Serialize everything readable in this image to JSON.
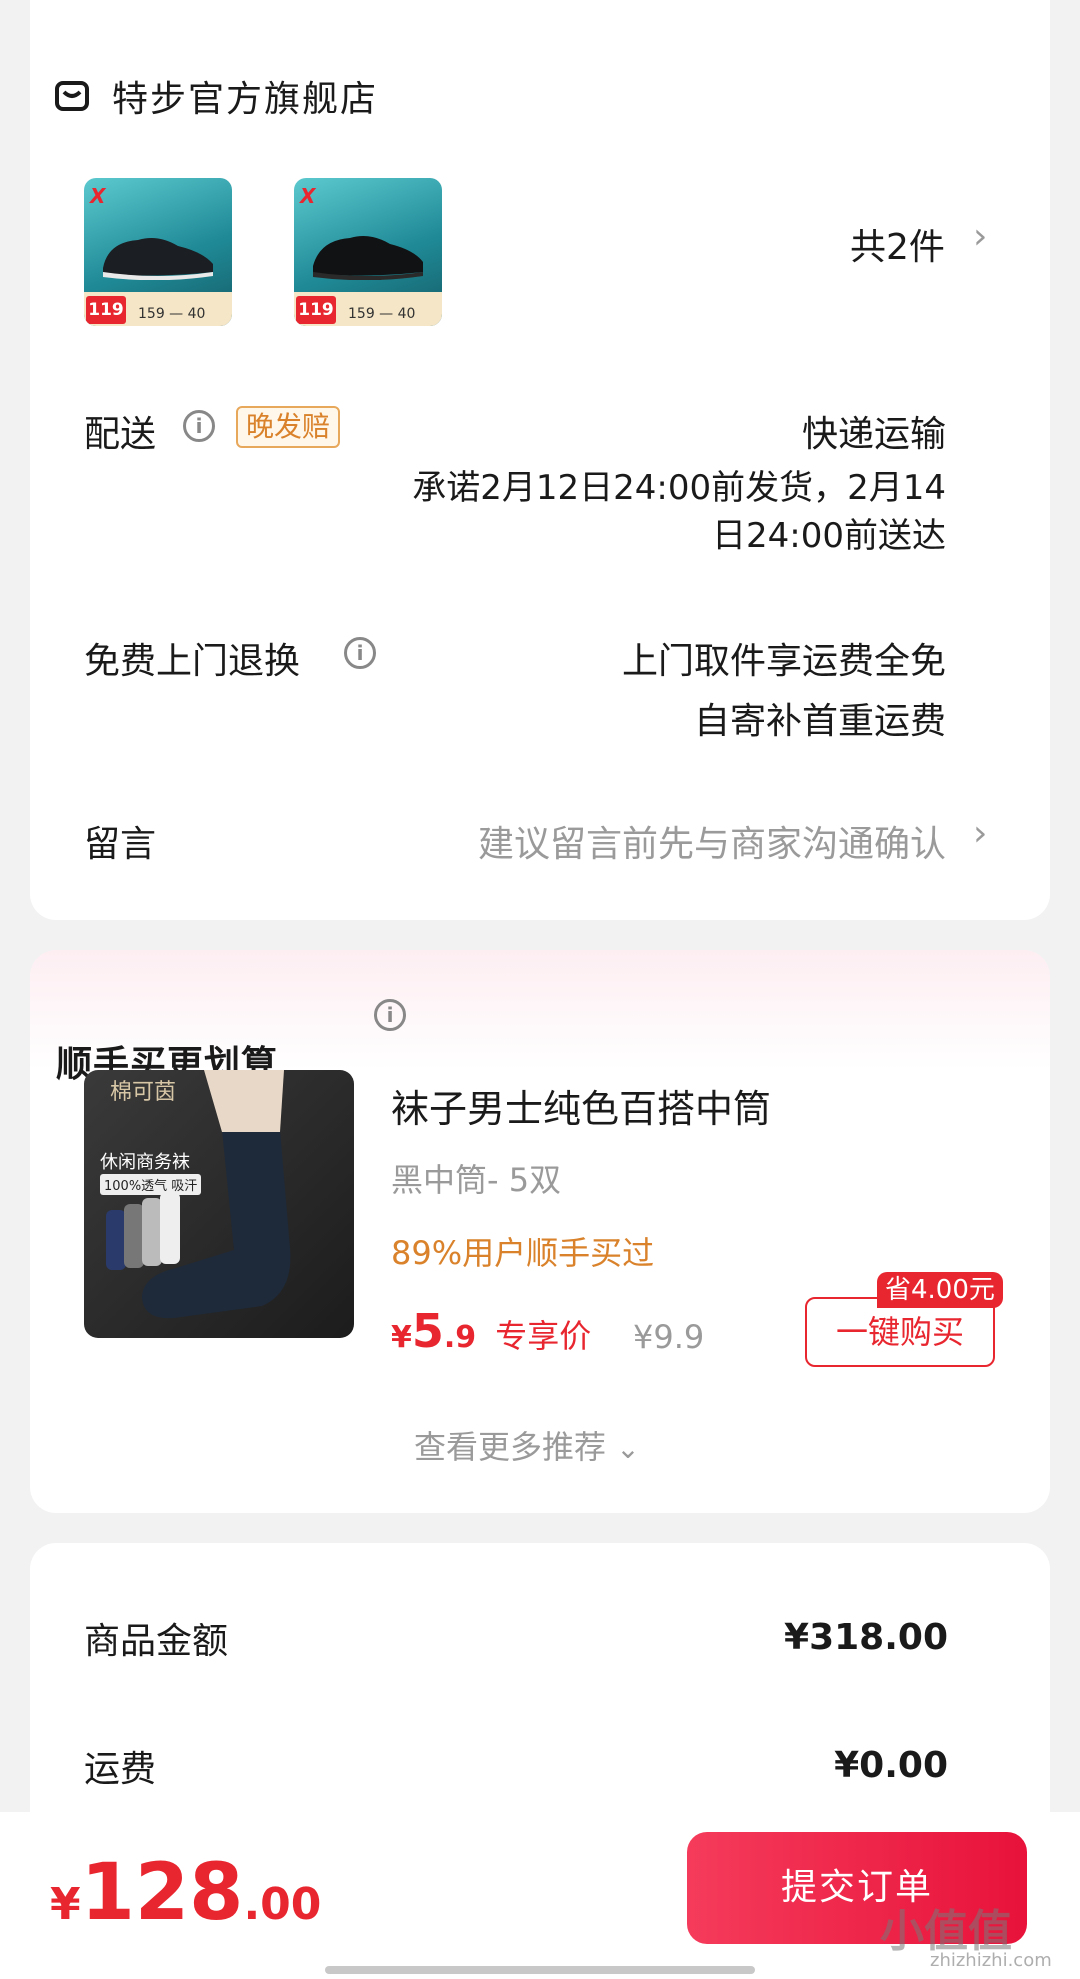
{
  "store": {
    "name": "特步官方旗舰店",
    "thumbnails": [
      {
        "logo": "X",
        "price": "119",
        "mini": "159 — 40"
      },
      {
        "logo": "X",
        "price": "119",
        "mini": "159 — 40"
      }
    ],
    "item_count": "共2件"
  },
  "delivery": {
    "label": "配送",
    "badge": "晚发赔",
    "method": "快递运输",
    "promise_line1": "承诺2月12日24:00前发货，2月14",
    "promise_line2": "日24:00前送达"
  },
  "returns": {
    "label": "免费上门退换",
    "line1": "上门取件享运费全免",
    "line2": "自寄补首重运费"
  },
  "message": {
    "label": "留言",
    "placeholder": "建议留言前先与商家沟通确认"
  },
  "addon": {
    "title": "顺手买更划算",
    "product_name": "袜子男士纯色百搭中筒",
    "spec": "黑中筒- 5双",
    "social_proof": "89%用户顺手买过",
    "price_symbol": "¥",
    "price_int": "5",
    "price_dec": ".9",
    "price_label": "专享价",
    "original_price": "¥9.9",
    "save_badge": "省4.00元",
    "buy_button": "一键购买",
    "more": "查看更多推荐",
    "image_brand": "棉可茵",
    "image_text1": "休闲商务袜",
    "image_text2": "100%透气 吸汗"
  },
  "summary": {
    "goods_label": "商品金额",
    "goods_value": "¥318.00",
    "shipping_label": "运费",
    "shipping_value": "¥0.00"
  },
  "bottom": {
    "currency": "¥",
    "total_int": "128",
    "total_dec": ".00",
    "submit": "提交订单",
    "watermark": "小值值",
    "watermark_sub": "zhizhizhi.com"
  },
  "colors": {
    "accent_red": "#e8262f",
    "orange": "#d9822b",
    "grey_text": "#9a9a9a"
  }
}
